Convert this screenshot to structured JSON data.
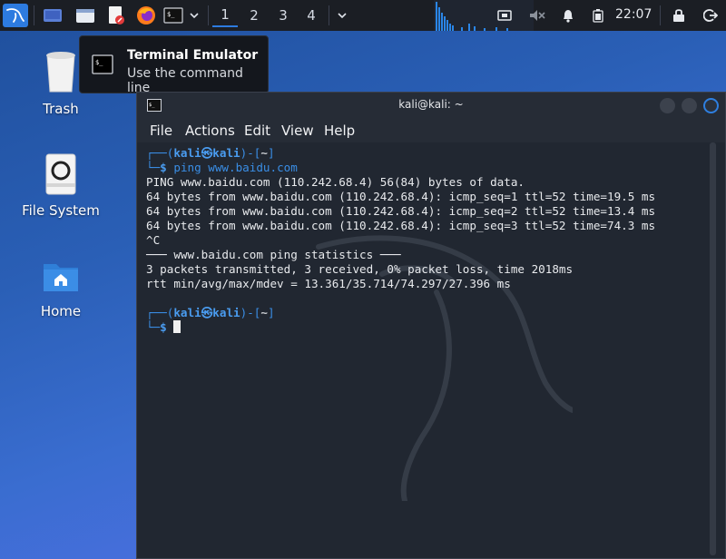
{
  "panel": {
    "workspaces": [
      "1",
      "2",
      "3",
      "4"
    ],
    "clock": "22:07"
  },
  "tooltip": {
    "title": "Terminal Emulator",
    "subtitle": "Use the command line"
  },
  "desktop": {
    "icons": [
      {
        "label": "Trash",
        "icon": "trash-icon"
      },
      {
        "label": "File System",
        "icon": "drive-icon"
      },
      {
        "label": "Home",
        "icon": "home-folder-icon"
      }
    ]
  },
  "terminal": {
    "title": "kali@kali: ~",
    "menu": [
      "File",
      "Actions",
      "Edit",
      "View",
      "Help"
    ],
    "prompt": {
      "user": "kali",
      "host": "kali",
      "dir": "~",
      "symbol": "$"
    },
    "command": "ping www.baidu.com",
    "output": [
      "PING www.baidu.com (110.242.68.4) 56(84) bytes of data.",
      "64 bytes from www.baidu.com (110.242.68.4): icmp_seq=1 ttl=52 time=19.5 ms",
      "64 bytes from www.baidu.com (110.242.68.4): icmp_seq=2 ttl=52 time=13.4 ms",
      "64 bytes from www.baidu.com (110.242.68.4): icmp_seq=3 ttl=52 time=74.3 ms",
      "^C",
      "─── www.baidu.com ping statistics ───",
      "3 packets transmitted, 3 received, 0% packet loss, time 2018ms",
      "rtt min/avg/max/mdev = 13.361/35.714/74.297/27.396 ms"
    ]
  },
  "colors": {
    "accent": "#2d7be0",
    "prompt_blue": "#3a8ee6",
    "terminal_bg": "#212731"
  }
}
